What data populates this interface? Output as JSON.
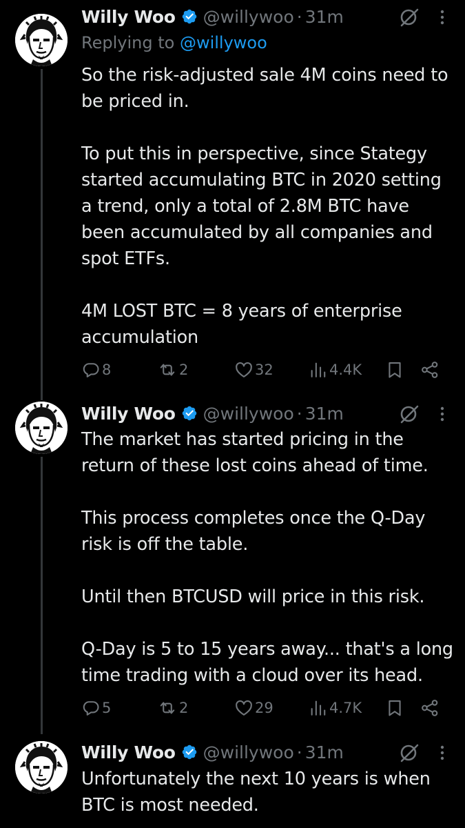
{
  "colors": {
    "background": "#000000",
    "text": "#e7e9ea",
    "secondary": "#71767b",
    "accent": "#1d9bf0",
    "thread_line": "#333639"
  },
  "tweets": [
    {
      "author": "Willy Woo",
      "handle": "@willywoo",
      "separator": "·",
      "time": "31m",
      "replying_prefix": "Replying to",
      "replying_to": "@willywoo",
      "text": "So the risk-adjusted sale 4M coins need to be priced in.\n\nTo put this in perspective, since Stategy started accumulating BTC in 2020 setting a trend, only a total of 2.8M BTC have been accumulated by all companies and spot ETFs.\n\n4M LOST BTC = 8 years of enterprise accumulation",
      "stats": {
        "replies": "8",
        "reposts": "2",
        "likes": "32",
        "views": "4.4K"
      }
    },
    {
      "author": "Willy Woo",
      "handle": "@willywoo",
      "separator": "·",
      "time": "31m",
      "text": "The market has started pricing in the return of these lost coins ahead of time.\n\nThis process completes once the Q-Day risk is off the table.\n\nUntil then BTCUSD will price in this risk.\n\nQ-Day is 5 to 15 years away... that's a long time trading with a cloud over its head.",
      "stats": {
        "replies": "5",
        "reposts": "2",
        "likes": "29",
        "views": "4.7K"
      }
    },
    {
      "author": "Willy Woo",
      "handle": "@willywoo",
      "separator": "·",
      "time": "31m",
      "text": "Unfortunately the next 10 years is when BTC is most needed."
    }
  ],
  "icons": {
    "verified": "verified-badge-icon",
    "grok": "grok-icon",
    "more": "more-options-icon",
    "reply": "reply-icon",
    "repost": "repost-icon",
    "like": "heart-icon",
    "views": "views-icon",
    "bookmark": "bookmark-icon",
    "share": "share-icon"
  }
}
